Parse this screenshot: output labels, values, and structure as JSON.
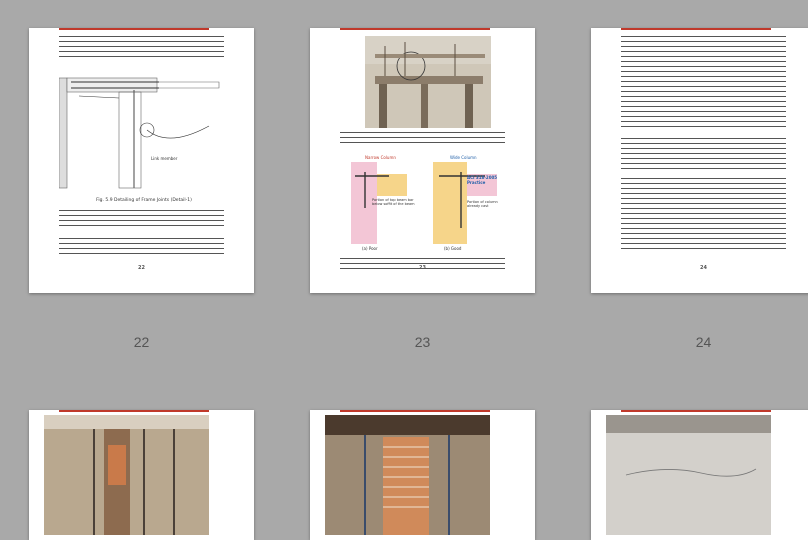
{
  "pages": [
    {
      "label": "22",
      "number": "22",
      "caption": "Fig. 5.9 Detailing of Frame Joints (Detail-1)",
      "side_label": "Link member"
    },
    {
      "label": "23",
      "number": "23",
      "narrow": "Narrow Column",
      "wide": "Wide Column",
      "aci": "ACI 318-2005 Practice",
      "poor": "(a) Poor",
      "good": "(b) Good",
      "portion_top": "Portion of top beam bar below soffit of the beam",
      "portion_col": "Portion of column already cast"
    },
    {
      "label": "24",
      "number": "24"
    },
    {
      "label": "",
      "number": ""
    },
    {
      "label": "",
      "number": ""
    },
    {
      "label": "",
      "number": ""
    }
  ],
  "colors": {
    "background": "#a9a9a9",
    "page": "#ffffff",
    "accent_line": "#c0392b"
  }
}
